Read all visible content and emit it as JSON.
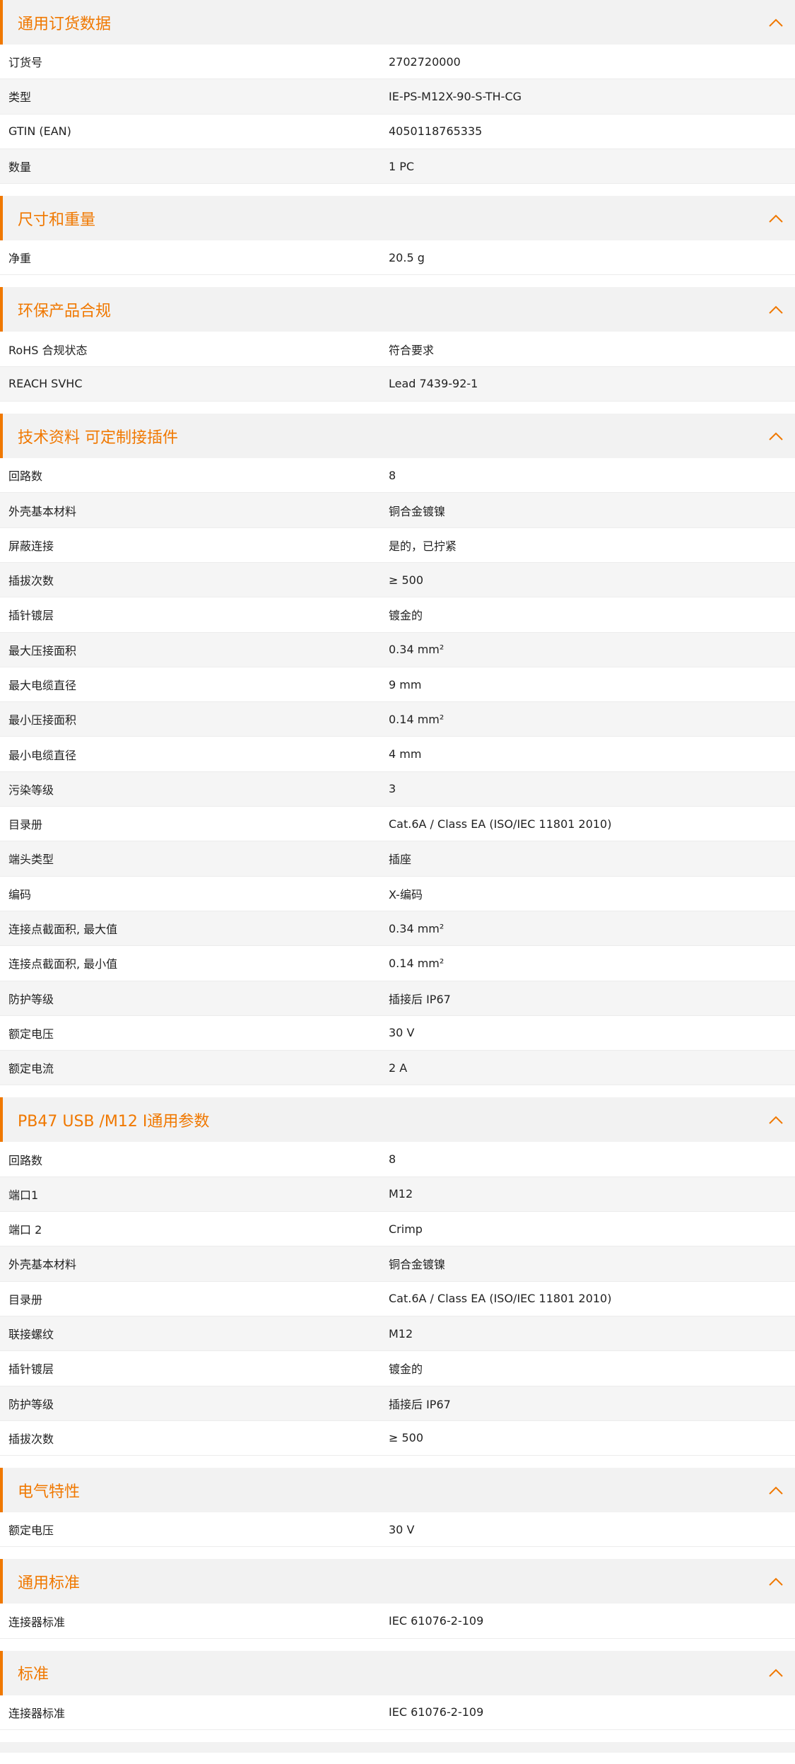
{
  "theme": {
    "accent": "#f07800",
    "header_bg": "#f2f2f2",
    "stripe_bg": "#f5f5f5"
  },
  "icons": {
    "collapse": "chevron-up-icon"
  },
  "sections": [
    {
      "title": "通用订货数据",
      "rows": [
        {
          "label": "订货号",
          "value": "2702720000"
        },
        {
          "label": "类型",
          "value": "IE-PS-M12X-90-S-TH-CG"
        },
        {
          "label": "GTIN (EAN)",
          "value": "4050118765335"
        },
        {
          "label": "数量",
          "value": "1  PC"
        }
      ]
    },
    {
      "title": "尺寸和重量",
      "rows": [
        {
          "label": "净重",
          "value": "20.5  g"
        }
      ]
    },
    {
      "title": "环保产品合规",
      "rows": [
        {
          "label": "RoHS 合规状态",
          "value": "符合要求"
        },
        {
          "label": "REACH SVHC",
          "value": "Lead 7439-92-1"
        }
      ]
    },
    {
      "title": "技术资料 可定制接插件",
      "rows": [
        {
          "label": "回路数",
          "value": "8"
        },
        {
          "label": "外壳基本材料",
          "value": "铜合金镀镍"
        },
        {
          "label": "屏蔽连接",
          "value": "是的，已拧紧"
        },
        {
          "label": "插拔次数",
          "value": "≥ 500"
        },
        {
          "label": "插针镀层",
          "value": "镀金的"
        },
        {
          "label": "最大压接面积",
          "value": "0.34  mm²"
        },
        {
          "label": "最大电缆直径",
          "value": "9  mm"
        },
        {
          "label": "最小压接面积",
          "value": "0.14  mm²"
        },
        {
          "label": "最小电缆直径",
          "value": "4  mm"
        },
        {
          "label": "污染等级",
          "value": "3"
        },
        {
          "label": "目录册",
          "value": "Cat.6A / Class EA (ISO/IEC 11801 2010)"
        },
        {
          "label": "端头类型",
          "value": "插座"
        },
        {
          "label": "编码",
          "value": "X-编码"
        },
        {
          "label": "连接点截面积, 最大值",
          "value": "0.34  mm²"
        },
        {
          "label": "连接点截面积, 最小值",
          "value": "0.14  mm²"
        },
        {
          "label": "防护等级",
          "value": "插接后 IP67"
        },
        {
          "label": "额定电压",
          "value": "30  V"
        },
        {
          "label": "额定电流",
          "value": "2  A"
        }
      ]
    },
    {
      "title": "PB47 USB /M12 I通用参数",
      "rows": [
        {
          "label": "回路数",
          "value": "8"
        },
        {
          "label": "端口1",
          "value": "M12"
        },
        {
          "label": "端口 2",
          "value": "Crimp"
        },
        {
          "label": "外壳基本材料",
          "value": "铜合金镀镍"
        },
        {
          "label": "目录册",
          "value": "Cat.6A / Class EA (ISO/IEC 11801 2010)"
        },
        {
          "label": "联接螺纹",
          "value": "M12"
        },
        {
          "label": "插针镀层",
          "value": "镀金的"
        },
        {
          "label": "防护等级",
          "value": "插接后 IP67"
        },
        {
          "label": "插拔次数",
          "value": "≥ 500"
        }
      ]
    },
    {
      "title": "电气特性",
      "rows": [
        {
          "label": "额定电压",
          "value": "30  V"
        }
      ]
    },
    {
      "title": "通用标准",
      "rows": [
        {
          "label": "连接器标准",
          "value": "IEC 61076-2-109"
        }
      ]
    },
    {
      "title": "标准",
      "rows": [
        {
          "label": "连接器标准",
          "value": "IEC 61076-2-109"
        }
      ]
    }
  ]
}
